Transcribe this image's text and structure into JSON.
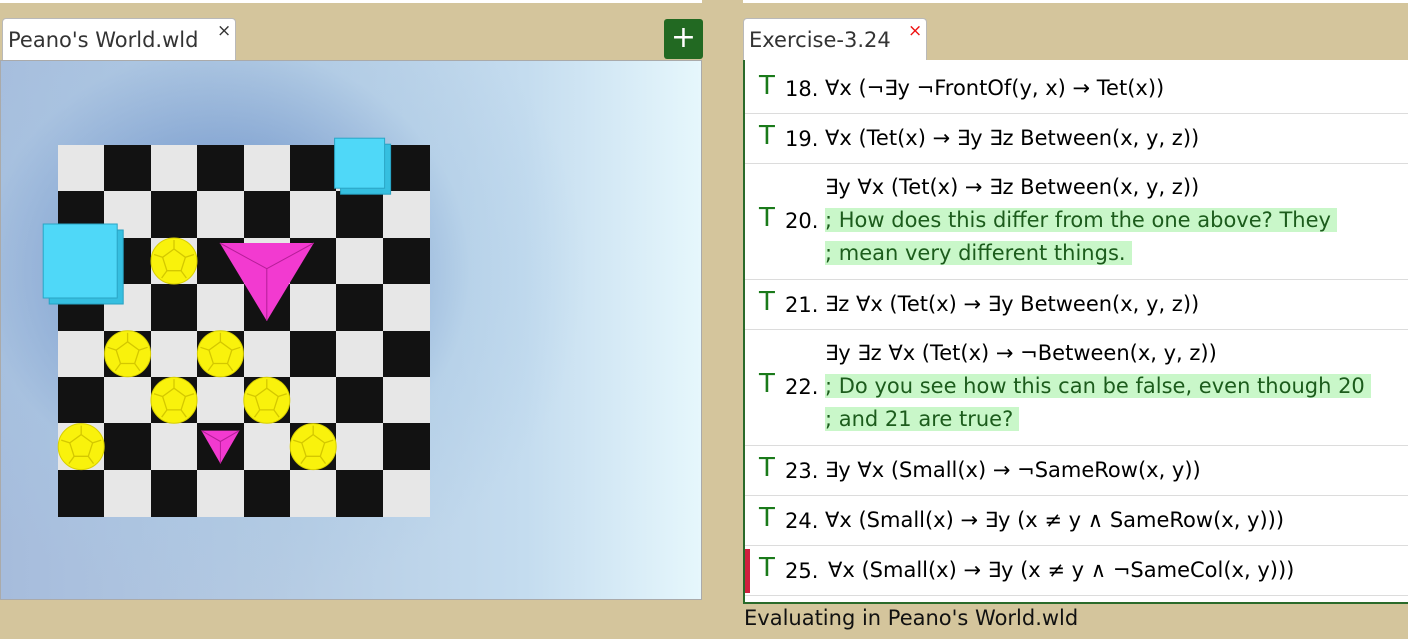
{
  "left_tab": {
    "title": "Peano's World.wld",
    "close": "×"
  },
  "add_button": {
    "label": "+"
  },
  "right_tab": {
    "title": "Exercise-3.24",
    "close": "×"
  },
  "colors": {
    "cube": "#4fd8f8",
    "tet": "#f23ad0",
    "dodec": "#f9f20c",
    "truth": "#1a7a1a",
    "add_button": "#226922",
    "current_marker": "#d0203f"
  },
  "world": {
    "board_size": 8,
    "objects": [
      {
        "shape": "cube",
        "size": "medium",
        "row": 0,
        "col": 6
      },
      {
        "shape": "cube",
        "size": "large",
        "row": 2,
        "col": 0
      },
      {
        "shape": "dodec",
        "size": "small",
        "row": 2,
        "col": 2
      },
      {
        "shape": "tet",
        "size": "large",
        "row": 2,
        "col": 4
      },
      {
        "shape": "dodec",
        "size": "small",
        "row": 4,
        "col": 1
      },
      {
        "shape": "dodec",
        "size": "small",
        "row": 4,
        "col": 3
      },
      {
        "shape": "dodec",
        "size": "small",
        "row": 5,
        "col": 2
      },
      {
        "shape": "dodec",
        "size": "small",
        "row": 5,
        "col": 4
      },
      {
        "shape": "dodec",
        "size": "small",
        "row": 6,
        "col": 0
      },
      {
        "shape": "tet",
        "size": "small",
        "row": 6,
        "col": 3
      },
      {
        "shape": "dodec",
        "size": "small",
        "row": 6,
        "col": 5
      }
    ]
  },
  "sentences": [
    {
      "value": "T",
      "num": "18.",
      "lines": [
        {
          "text": "∀x (¬∃y ¬FrontOf(y, x) → Tet(x))",
          "comment": false
        }
      ]
    },
    {
      "value": "T",
      "num": "19.",
      "lines": [
        {
          "text": "∀x (Tet(x) → ∃y ∃z Between(x, y, z))",
          "comment": false
        }
      ]
    },
    {
      "value": "T",
      "num": "20.",
      "lines": [
        {
          "text": "∃y ∀x (Tet(x) → ∃z Between(x, y, z))",
          "comment": false
        },
        {
          "text": "; How does this differ from the one above?  They",
          "comment": true
        },
        {
          "text": "; mean very different things.",
          "comment": true
        }
      ]
    },
    {
      "value": "T",
      "num": "21.",
      "lines": [
        {
          "text": "∃z ∀x (Tet(x) → ∃y Between(x, y, z))",
          "comment": false
        }
      ]
    },
    {
      "value": "T",
      "num": "22.",
      "lines": [
        {
          "text": "∃y ∃z ∀x (Tet(x) → ¬Between(x, y, z))",
          "comment": false
        },
        {
          "text": "; Do you see how this can be false, even though 20",
          "comment": true
        },
        {
          "text": "; and 21 are true?",
          "comment": true
        }
      ]
    },
    {
      "value": "T",
      "num": "23.",
      "lines": [
        {
          "text": "∃y ∀x (Small(x) → ¬SameRow(x, y))",
          "comment": false
        }
      ]
    },
    {
      "value": "T",
      "num": "24.",
      "lines": [
        {
          "text": "∀x (Small(x) → ∃y (x ≠ y ∧ SameRow(x, y)))",
          "comment": false
        }
      ]
    },
    {
      "value": "T",
      "num": "25.",
      "current": true,
      "lines": [
        {
          "text": "∀x (Small(x) → ∃y (x ≠ y ∧ ¬SameCol(x, y)))",
          "comment": false
        }
      ]
    }
  ],
  "status": "Evaluating in Peano's World.wld"
}
